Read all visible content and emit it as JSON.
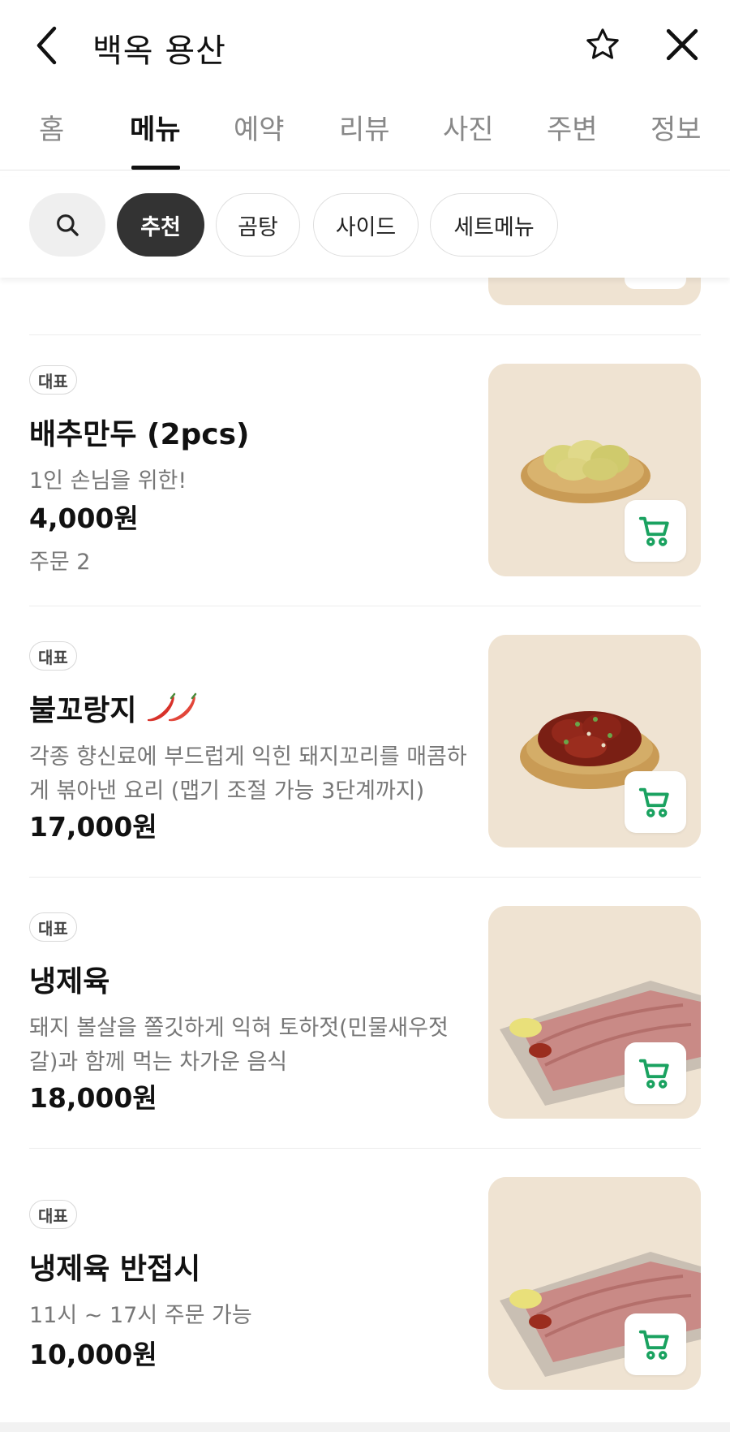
{
  "header": {
    "title": "백옥 용산"
  },
  "tabs": [
    "홈",
    "메뉴",
    "예약",
    "리뷰",
    "사진",
    "주변",
    "정보"
  ],
  "active_tab": "메뉴",
  "filters": [
    "추천",
    "곰탕",
    "사이드",
    "세트메뉴"
  ],
  "active_filter": "추천",
  "colors": {
    "accent": "#1aa260",
    "chip_active": "#333333",
    "image_bg": "#efe3d2"
  },
  "items": [
    {
      "badge": "대표",
      "name": "배추만두 (2pcs)",
      "description": "1인 손님을 위한!",
      "price": "4,000원",
      "orders": "주문 2",
      "image": "dumplings-in-brass-bowl"
    },
    {
      "badge": "대표",
      "name": "불꼬랑지",
      "spicy_icon": "chili-peppers-icon",
      "description": "각종 향신료에 부드럽게 익힌 돼지꼬리를 매콤하게 볶아낸 요리 (맵기 조절 가능 3단계까지)",
      "price": "17,000원",
      "image": "spicy-pork-tail-in-brass-bowl"
    },
    {
      "badge": "대표",
      "name": "냉제육",
      "description": "돼지 볼살을 쫄깃하게 익혀 토하젓(민물새우젓갈)과 함께 먹는 차가운 음식",
      "price": "18,000원",
      "image": "sliced-cold-pork-plate"
    },
    {
      "badge": "대표",
      "name": "냉제육 반접시",
      "description": "11시 ~ 17시 주문 가능",
      "price": "10,000원",
      "image": "sliced-cold-pork-plate"
    }
  ]
}
